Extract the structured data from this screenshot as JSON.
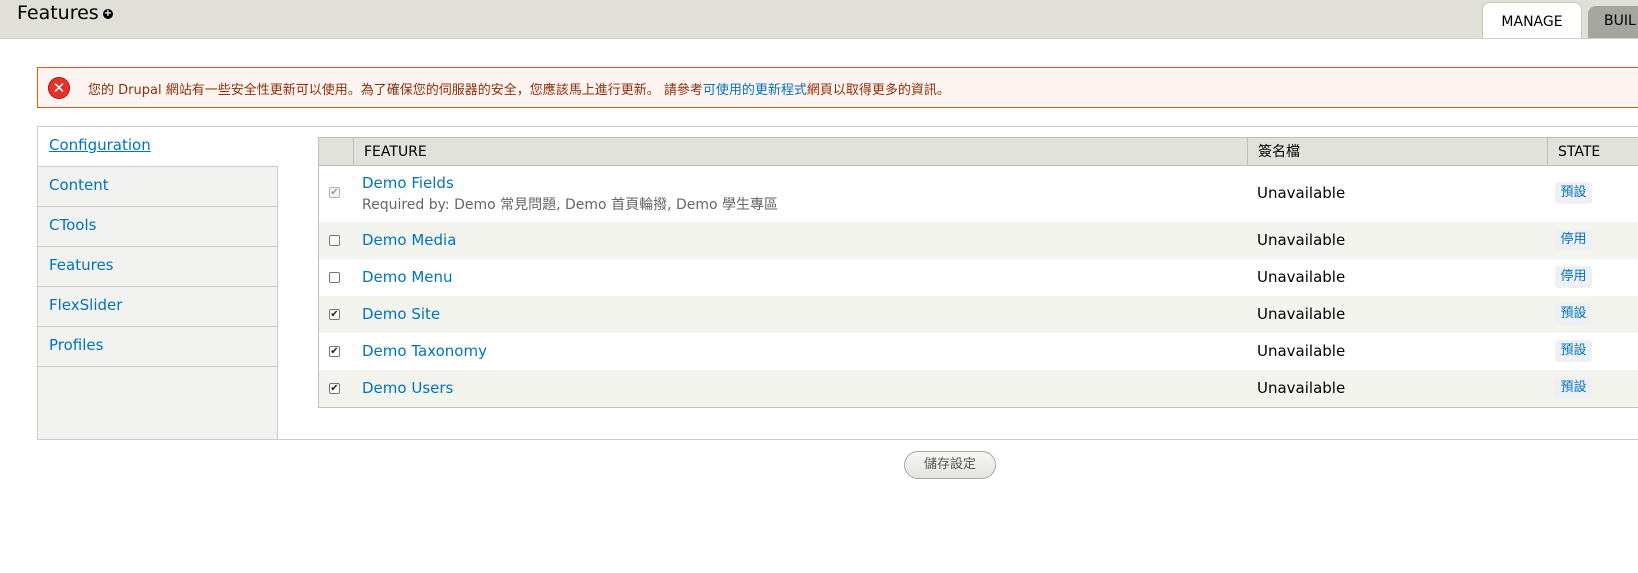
{
  "header": {
    "title": "Features",
    "add_shortcut_icon": "plus-circle-icon",
    "tabs": [
      {
        "label": "MANAGE"
      },
      {
        "label": "BUIL"
      }
    ]
  },
  "message": {
    "icon": "error-x-icon",
    "text_before": "您的 Drupal 網站有一些安全性更新可以使用。為了確保您的伺服器的安全，您應該馬上進行更新。 請參考",
    "link_text": "可使用的更新程式",
    "text_after": "網頁以取得更多的資訊。",
    "colors": {
      "border": "#ed541d",
      "background": "#fef5f1",
      "text": "#8c2e0b"
    }
  },
  "sidebar": {
    "items": [
      {
        "label": "Configuration"
      },
      {
        "label": "Content"
      },
      {
        "label": "CTools"
      },
      {
        "label": "Features"
      },
      {
        "label": "FlexSlider"
      },
      {
        "label": "Profiles"
      }
    ]
  },
  "table": {
    "columns": {
      "feature": "FEATURE",
      "signature": "簽名檔",
      "state": "STATE"
    },
    "rows": [
      {
        "name": "Demo Fields",
        "description": "Required by: Demo 常見問題, Demo 首頁輪撥, Demo 學生專區",
        "checked": true,
        "disabled": true,
        "signature": "Unavailable",
        "state": "預設"
      },
      {
        "name": "Demo Media",
        "checked": false,
        "disabled": false,
        "signature": "Unavailable",
        "state": "停用"
      },
      {
        "name": "Demo Menu",
        "checked": false,
        "disabled": false,
        "signature": "Unavailable",
        "state": "停用"
      },
      {
        "name": "Demo Site",
        "checked": true,
        "disabled": false,
        "signature": "Unavailable",
        "state": "預設"
      },
      {
        "name": "Demo Taxonomy",
        "checked": true,
        "disabled": false,
        "signature": "Unavailable",
        "state": "預設"
      },
      {
        "name": "Demo Users",
        "checked": true,
        "disabled": false,
        "signature": "Unavailable",
        "state": "預設"
      }
    ]
  },
  "actions": {
    "save_label": "儲存設定"
  },
  "colors": {
    "link": "#0074bd",
    "header_bg": "#e0e0d8",
    "row_alt": "#f3f4ee"
  }
}
